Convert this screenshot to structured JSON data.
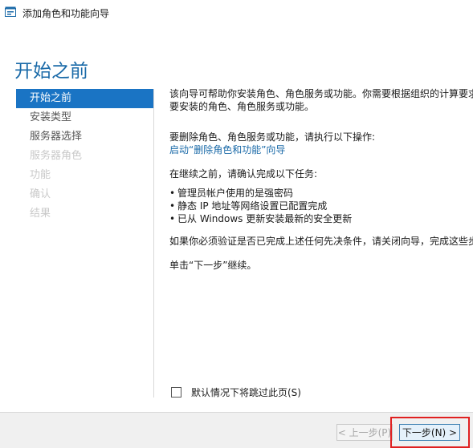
{
  "window": {
    "title": "添加角色和功能向导",
    "icon": "wizard-icon"
  },
  "page": {
    "heading": "开始之前"
  },
  "nav": {
    "items": [
      {
        "label": "开始之前",
        "state": "active"
      },
      {
        "label": "安装类型",
        "state": "normal"
      },
      {
        "label": "服务器选择",
        "state": "normal"
      },
      {
        "label": "服务器角色",
        "state": "disabled"
      },
      {
        "label": "功能",
        "state": "disabled"
      },
      {
        "label": "确认",
        "state": "disabled"
      },
      {
        "label": "结果",
        "state": "disabled"
      }
    ]
  },
  "content": {
    "intro_line1": "该向导可帮助你安装角色、角色服务或功能。你需要根据组织的计算要求",
    "intro_line2": "要安装的角色、角色服务或功能。",
    "remove_text": "要删除角色、角色服务或功能，请执行以下操作:",
    "remove_link": "启动“删除角色和功能”向导",
    "confirm_text": "在继续之前，请确认完成以下任务:",
    "tasks": [
      "管理员帐户使用的是强密码",
      "静态 IP 地址等网络设置已配置完成",
      "已从 Windows 更新安装最新的安全更新"
    ],
    "verify_text": "如果你必须验证是否已完成上述任何先决条件，请关闭向导，完成这些步",
    "next_hint": "单击“下一步”继续。"
  },
  "skip": {
    "label": "默认情况下将跳过此页(S)",
    "checked": false
  },
  "footer": {
    "prev_label": "< 上一步(P)",
    "next_label": "下一步(N) >"
  },
  "colors": {
    "accent": "#1a74c4",
    "heading": "#1a6aa8",
    "highlight": "#e02020"
  }
}
